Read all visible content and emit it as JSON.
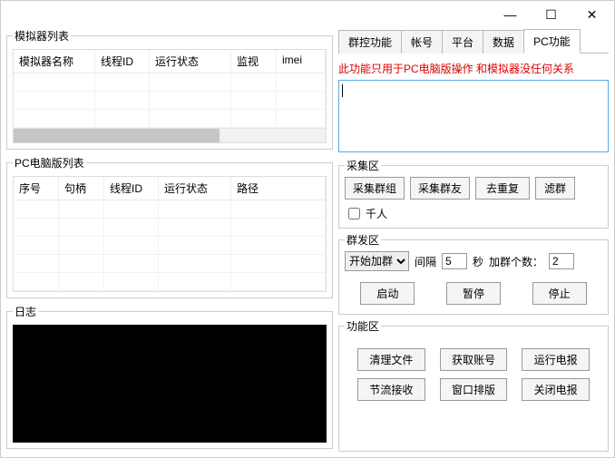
{
  "titlebar": {
    "min": "—",
    "max": "☐",
    "close": "✕"
  },
  "left": {
    "emuList": {
      "legend": "模拟器列表",
      "cols": [
        "模拟器名称",
        "线程ID",
        "运行状态",
        "监视",
        "imei"
      ]
    },
    "pcList": {
      "legend": "PC电脑版列表",
      "cols": [
        "序号",
        "句柄",
        "线程ID",
        "运行状态",
        "路径"
      ]
    },
    "log": {
      "legend": "日志"
    }
  },
  "tabs": [
    "群控功能",
    "帐号",
    "平台",
    "数据",
    "PC功能"
  ],
  "activeTab": 4,
  "pc": {
    "warn": "此功能只用于PC电脑版操作 和模拟器没任何关系",
    "collect": {
      "legend": "采集区",
      "btnGroup": "采集群组",
      "btnFriend": "采集群友",
      "btnDedup": "去重复",
      "btnFilter": "滤群",
      "chkThousand": "千人"
    },
    "send": {
      "legend": "群发区",
      "selStart": "开始加群",
      "lblInterval": "间隔",
      "valInterval": "5",
      "lblSec": "秒",
      "lblCount": "加群个数：",
      "valCount": "2",
      "btnStart": "启动",
      "btnPause": "暂停",
      "btnStop": "停止"
    },
    "fn": {
      "legend": "功能区",
      "b1": "清理文件",
      "b2": "获取账号",
      "b3": "运行电报",
      "b4": "节流接收",
      "b5": "窗口排版",
      "b6": "关闭电报"
    }
  }
}
